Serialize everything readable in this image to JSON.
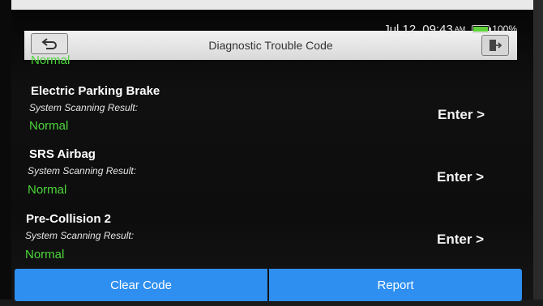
{
  "status_bar": {
    "date": "Jul 12",
    "time": "09:43",
    "ampm": "AM",
    "battery": "100%",
    "battery_level": 1.0
  },
  "header": {
    "title": "Diagnostic Trouble Code",
    "back_icon": "back-arrow-icon",
    "exit_icon": "exit-door-icon"
  },
  "list": {
    "partial_top_result": "Normal",
    "items": [
      {
        "name": "Electric Parking Brake",
        "label": "System Scanning Result:",
        "result": "Normal",
        "action": "Enter >"
      },
      {
        "name": "SRS Airbag",
        "label": "System Scanning Result:",
        "result": "Normal",
        "action": "Enter >"
      },
      {
        "name": "Pre-Collision 2",
        "label": "System Scanning Result:",
        "result": "Normal",
        "action": "Enter >"
      }
    ]
  },
  "footer": {
    "clear_code": "Clear Code",
    "report": "Report"
  },
  "colors": {
    "accent": "#2e8ff0",
    "normal_green": "#4cd63a",
    "battery_green": "#5fd13a"
  }
}
